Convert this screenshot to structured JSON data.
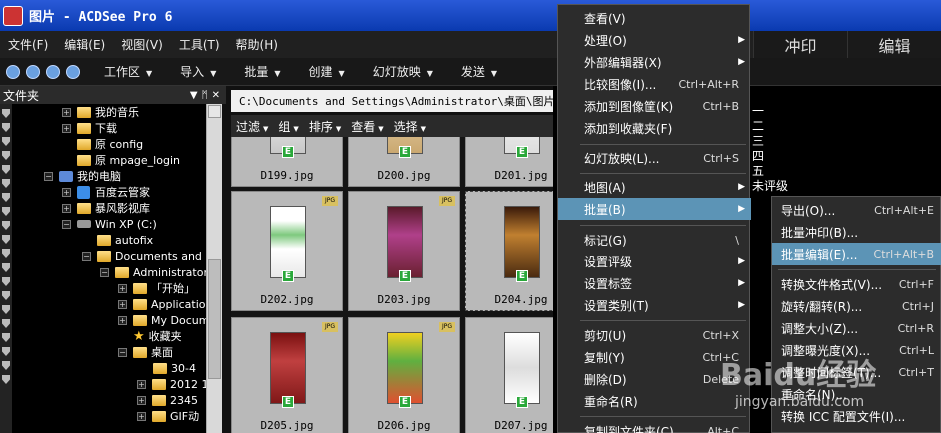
{
  "window": {
    "title": "图片 - ACDSee Pro 6"
  },
  "menubar": [
    "文件(F)",
    "编辑(E)",
    "视图(V)",
    "工具(T)",
    "帮助(H)"
  ],
  "modes": [
    "冲印",
    "编辑"
  ],
  "toolbar": [
    "工作区",
    "导入",
    "批量",
    "创建",
    "幻灯放映",
    "发送"
  ],
  "folders": {
    "title": "文件夹",
    "items": [
      {
        "label": "我的音乐",
        "icon": "folder-icon"
      },
      {
        "label": "下载",
        "icon": "folder-icon"
      },
      {
        "label": "原 config",
        "icon": "folder-icon"
      },
      {
        "label": "原 mpage_login",
        "icon": "folder-icon"
      },
      {
        "label": "我的电脑",
        "icon": "computer-icon"
      },
      {
        "label": "百度云管家",
        "icon": "app-icon"
      },
      {
        "label": "暴风影视库",
        "icon": "folder-icon"
      },
      {
        "label": "Win XP (C:)",
        "icon": "drive-icon"
      },
      {
        "label": "autofix",
        "icon": "folder-icon"
      },
      {
        "label": "Documents and Se",
        "icon": "folder-icon"
      },
      {
        "label": "Administrator",
        "icon": "folder-icon"
      },
      {
        "label": "「开始」",
        "icon": "folder-icon"
      },
      {
        "label": "Application",
        "icon": "folder-icon"
      },
      {
        "label": "My Docum",
        "icon": "folder-icon"
      },
      {
        "label": "收藏夹",
        "icon": "star-icon"
      },
      {
        "label": "桌面",
        "icon": "folder-icon"
      },
      {
        "label": "30-4",
        "icon": "folder-icon"
      },
      {
        "label": "2012 1",
        "icon": "folder-icon"
      },
      {
        "label": "2345",
        "icon": "folder-icon"
      },
      {
        "label": "GIF动",
        "icon": "folder-icon"
      }
    ]
  },
  "browser": {
    "path": "C:\\Documents and Settings\\Administrator\\桌面\\图片",
    "filters": [
      "过滤",
      "组",
      "排序",
      "查看",
      "选择"
    ],
    "files": [
      "D199.jpg",
      "D200.jpg",
      "D201.jpg",
      "D202.jpg",
      "D203.jpg",
      "D204.jpg",
      "D205.jpg",
      "D206.jpg",
      "D207.jpg"
    ],
    "badge_e": "E",
    "badge_jpg": "JPG"
  },
  "side_text": [
    "一",
    "二",
    "三",
    "四",
    "五",
    "未评级"
  ],
  "context_menu": [
    {
      "label": "查看(V)",
      "shortcut": ""
    },
    {
      "label": "处理(O)",
      "shortcut": "",
      "submenu": true
    },
    {
      "label": "外部编辑器(X)",
      "shortcut": "",
      "submenu": true
    },
    {
      "label": "比较图像(I)...",
      "shortcut": "Ctrl+Alt+R"
    },
    {
      "label": "添加到图像筐(K)",
      "shortcut": "Ctrl+B"
    },
    {
      "label": "添加到收藏夹(F)",
      "shortcut": ""
    },
    {
      "label": "幻灯放映(L)...",
      "shortcut": "Ctrl+S"
    },
    {
      "label": "地图(A)",
      "shortcut": "",
      "submenu": true
    },
    {
      "label": "批量(B)",
      "shortcut": "",
      "submenu": true,
      "highlighted": true
    },
    {
      "label": "标记(G)",
      "shortcut": "\\"
    },
    {
      "label": "设置评级",
      "shortcut": "",
      "submenu": true
    },
    {
      "label": "设置标签",
      "shortcut": "",
      "submenu": true
    },
    {
      "label": "设置类别(T)",
      "shortcut": "",
      "submenu": true
    },
    {
      "label": "剪切(U)",
      "shortcut": "Ctrl+X"
    },
    {
      "label": "复制(Y)",
      "shortcut": "Ctrl+C"
    },
    {
      "label": "删除(D)",
      "shortcut": "Delete"
    },
    {
      "label": "重命名(R)",
      "shortcut": ""
    },
    {
      "label": "复制到文件夹(C)",
      "shortcut": "Alt+C"
    }
  ],
  "batch_submenu": [
    {
      "label": "导出(O)...",
      "shortcut": "Ctrl+Alt+E"
    },
    {
      "label": "批量冲印(B)...",
      "shortcut": ""
    },
    {
      "label": "批量编辑(E)...",
      "shortcut": "Ctrl+Alt+B",
      "highlighted": true
    },
    {
      "label": "转换文件格式(V)...",
      "shortcut": "Ctrl+F"
    },
    {
      "label": "旋转/翻转(R)...",
      "shortcut": "Ctrl+J"
    },
    {
      "label": "调整大小(Z)...",
      "shortcut": "Ctrl+R"
    },
    {
      "label": "调整曝光度(X)...",
      "shortcut": "Ctrl+L"
    },
    {
      "label": "调整时间标签(T)...",
      "shortcut": "Ctrl+T"
    },
    {
      "label": "重命名(N)...",
      "shortcut": ""
    },
    {
      "label": "转换 ICC 配置文件(I)...",
      "shortcut": ""
    }
  ],
  "watermark": {
    "brand": "Baidu经验",
    "url": "jingyan.baidu.com"
  }
}
